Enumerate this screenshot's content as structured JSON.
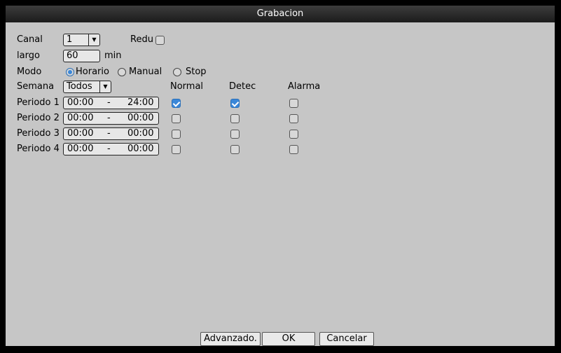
{
  "title": "Grabacion",
  "canal": {
    "label": "Canal",
    "value": "1"
  },
  "redu": {
    "label": "Redu",
    "checked": false
  },
  "largo": {
    "label": "largo",
    "value": "60",
    "unit": "min"
  },
  "modo": {
    "label": "Modo",
    "options": [
      "Horario",
      "Manual",
      "Stop"
    ],
    "selected": "Horario"
  },
  "semana": {
    "label": "Semana",
    "value": "Todos"
  },
  "columns": {
    "normal": "Normal",
    "detec": "Detec",
    "alarma": "Alarma"
  },
  "periods": [
    {
      "label": "Periodo 1",
      "start": "00:00",
      "sep": "-",
      "end": "24:00",
      "normal": true,
      "detec": true,
      "alarma": false
    },
    {
      "label": "Periodo 2",
      "start": "00:00",
      "sep": "-",
      "end": "00:00",
      "normal": false,
      "detec": false,
      "alarma": false
    },
    {
      "label": "Periodo 3",
      "start": "00:00",
      "sep": "-",
      "end": "00:00",
      "normal": false,
      "detec": false,
      "alarma": false
    },
    {
      "label": "Periodo 4",
      "start": "00:00",
      "sep": "-",
      "end": "00:00",
      "normal": false,
      "detec": false,
      "alarma": false
    }
  ],
  "buttons": {
    "advanced": "Advanzado.",
    "ok": "OK",
    "cancel": "Cancelar"
  },
  "colors": {
    "background": "#c6c6c6",
    "titlebar": "#2a2a2a",
    "accent": "#3a87d8"
  }
}
